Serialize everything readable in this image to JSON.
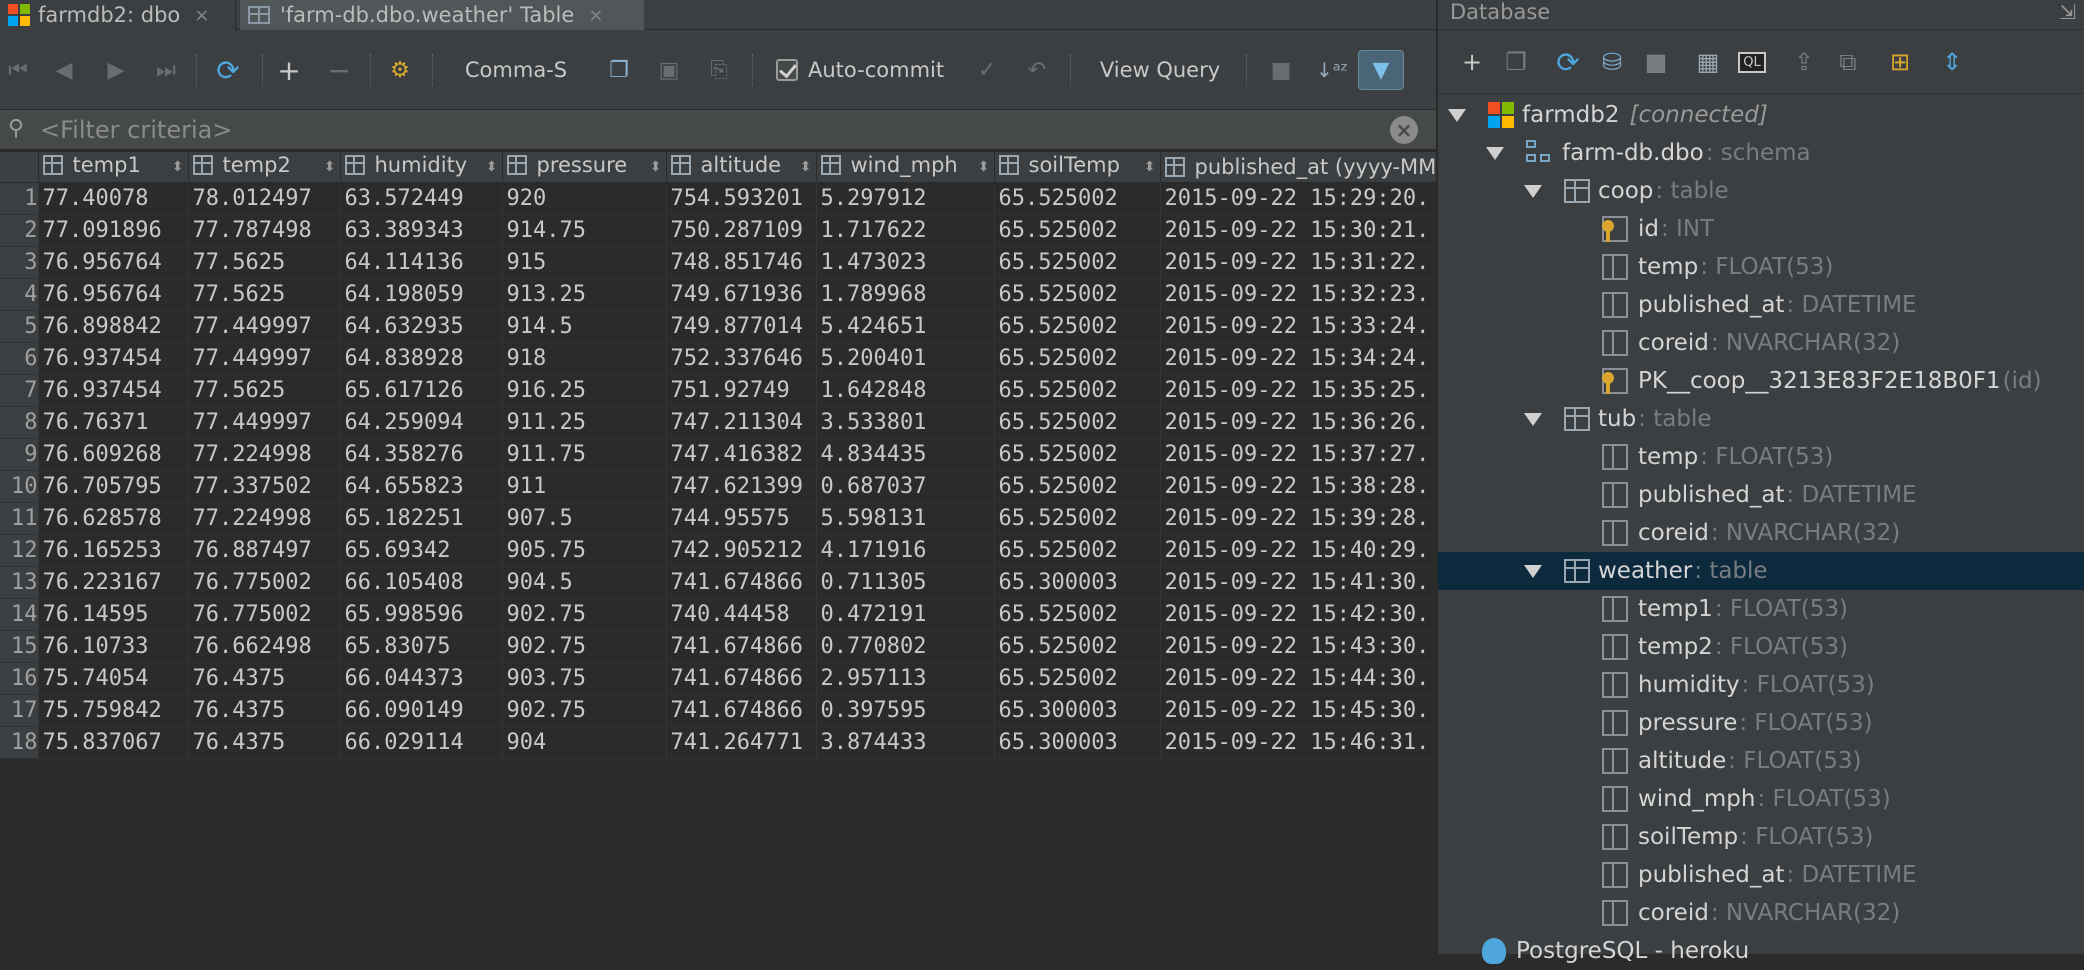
{
  "tabs": [
    {
      "label": "farmdb2: dbo",
      "close": "×"
    },
    {
      "label": "'farm-db.dbo.weather' Table",
      "close": "×"
    }
  ],
  "toolbar": {
    "comma_label": "Comma-S",
    "autocommit_label": "Auto-commit",
    "autocommit_checked": true,
    "view_query_label": "View Query"
  },
  "filter": {
    "placeholder": "<Filter criteria>"
  },
  "grid": {
    "columns": [
      "temp1",
      "temp2",
      "humidity",
      "pressure",
      "altitude",
      "wind_mph",
      "soilTemp",
      "published_at (yyyy-MM"
    ],
    "rows": [
      {
        "n": "1",
        "cells": [
          "77.40078",
          "78.012497",
          "63.572449",
          "920",
          "754.593201",
          "5.297912",
          "65.525002",
          "2015-09-22 15:29:20."
        ]
      },
      {
        "n": "2",
        "cells": [
          "77.091896",
          "77.787498",
          "63.389343",
          "914.75",
          "750.287109",
          "1.717622",
          "65.525002",
          "2015-09-22 15:30:21."
        ]
      },
      {
        "n": "3",
        "cells": [
          "76.956764",
          "77.5625",
          "64.114136",
          "915",
          "748.851746",
          "1.473023",
          "65.525002",
          "2015-09-22 15:31:22."
        ]
      },
      {
        "n": "4",
        "cells": [
          "76.956764",
          "77.5625",
          "64.198059",
          "913.25",
          "749.671936",
          "1.789968",
          "65.525002",
          "2015-09-22 15:32:23."
        ]
      },
      {
        "n": "5",
        "cells": [
          "76.898842",
          "77.449997",
          "64.632935",
          "914.5",
          "749.877014",
          "5.424651",
          "65.525002",
          "2015-09-22 15:33:24."
        ]
      },
      {
        "n": "6",
        "cells": [
          "76.937454",
          "77.449997",
          "64.838928",
          "918",
          "752.337646",
          "5.200401",
          "65.525002",
          "2015-09-22 15:34:24."
        ]
      },
      {
        "n": "7",
        "cells": [
          "76.937454",
          "77.5625",
          "65.617126",
          "916.25",
          "751.92749",
          "1.642848",
          "65.525002",
          "2015-09-22 15:35:25."
        ]
      },
      {
        "n": "8",
        "cells": [
          "76.76371",
          "77.449997",
          "64.259094",
          "911.25",
          "747.211304",
          "3.533801",
          "65.525002",
          "2015-09-22 15:36:26."
        ]
      },
      {
        "n": "9",
        "cells": [
          "76.609268",
          "77.224998",
          "64.358276",
          "911.75",
          "747.416382",
          "4.834435",
          "65.525002",
          "2015-09-22 15:37:27."
        ]
      },
      {
        "n": "10",
        "cells": [
          "76.705795",
          "77.337502",
          "64.655823",
          "911",
          "747.621399",
          "0.687037",
          "65.525002",
          "2015-09-22 15:38:28."
        ]
      },
      {
        "n": "11",
        "cells": [
          "76.628578",
          "77.224998",
          "65.182251",
          "907.5",
          "744.95575",
          "5.598131",
          "65.525002",
          "2015-09-22 15:39:28."
        ]
      },
      {
        "n": "12",
        "cells": [
          "76.165253",
          "76.887497",
          "65.69342",
          "905.75",
          "742.905212",
          "4.171916",
          "65.525002",
          "2015-09-22 15:40:29."
        ]
      },
      {
        "n": "13",
        "cells": [
          "76.223167",
          "76.775002",
          "66.105408",
          "904.5",
          "741.674866",
          "0.711305",
          "65.300003",
          "2015-09-22 15:41:30."
        ]
      },
      {
        "n": "14",
        "cells": [
          "76.14595",
          "76.775002",
          "65.998596",
          "902.75",
          "740.44458",
          "0.472191",
          "65.525002",
          "2015-09-22 15:42:30."
        ]
      },
      {
        "n": "15",
        "cells": [
          "76.10733",
          "76.662498",
          "65.83075",
          "902.75",
          "741.674866",
          "0.770802",
          "65.525002",
          "2015-09-22 15:43:30."
        ]
      },
      {
        "n": "16",
        "cells": [
          "75.74054",
          "76.4375",
          "66.044373",
          "903.75",
          "741.674866",
          "2.957113",
          "65.525002",
          "2015-09-22 15:44:30."
        ]
      },
      {
        "n": "17",
        "cells": [
          "75.759842",
          "76.4375",
          "66.090149",
          "902.75",
          "741.674866",
          "0.397595",
          "65.300003",
          "2015-09-22 15:45:30."
        ]
      },
      {
        "n": "18",
        "cells": [
          "75.837067",
          "76.4375",
          "66.029114",
          "904",
          "741.264771",
          "3.874433",
          "65.300003",
          "2015-09-22 15:46:31."
        ]
      }
    ]
  },
  "database": {
    "title": "Database",
    "tree": [
      {
        "name": "farmdb2",
        "extra": "[connected]",
        "icon": "ms-logo"
      },
      {
        "name": "farm-db.dbo",
        "type": ": schema",
        "icon": "schema-icon"
      },
      {
        "name": "coop",
        "type": ": table",
        "icon": "table-icon"
      },
      {
        "name": "id",
        "type": ": INT",
        "icon": "key-column-icon"
      },
      {
        "name": "temp",
        "type": ": FLOAT(53)",
        "icon": "column-icon"
      },
      {
        "name": "published_at",
        "type": ": DATETIME",
        "icon": "column-icon"
      },
      {
        "name": "coreid",
        "type": ": NVARCHAR(32)",
        "icon": "column-icon"
      },
      {
        "name": "PK__coop__3213E83F2E18B0F1",
        "type": " (id)",
        "icon": "primary-key-icon"
      },
      {
        "name": "tub",
        "type": ": table",
        "icon": "table-icon"
      },
      {
        "name": "temp",
        "type": ": FLOAT(53)",
        "icon": "column-icon"
      },
      {
        "name": "published_at",
        "type": ": DATETIME",
        "icon": "column-icon"
      },
      {
        "name": "coreid",
        "type": ": NVARCHAR(32)",
        "icon": "column-icon"
      },
      {
        "name": "weather",
        "type": ": table",
        "icon": "table-icon"
      },
      {
        "name": "temp1",
        "type": ": FLOAT(53)",
        "icon": "column-icon"
      },
      {
        "name": "temp2",
        "type": ": FLOAT(53)",
        "icon": "column-icon"
      },
      {
        "name": "humidity",
        "type": ": FLOAT(53)",
        "icon": "column-icon"
      },
      {
        "name": "pressure",
        "type": ": FLOAT(53)",
        "icon": "column-icon"
      },
      {
        "name": "altitude",
        "type": ": FLOAT(53)",
        "icon": "column-icon"
      },
      {
        "name": "wind_mph",
        "type": ": FLOAT(53)",
        "icon": "column-icon"
      },
      {
        "name": "soilTemp",
        "type": ": FLOAT(53)",
        "icon": "column-icon"
      },
      {
        "name": "published_at",
        "type": ": DATETIME",
        "icon": "column-icon"
      },
      {
        "name": "coreid",
        "type": ": NVARCHAR(32)",
        "icon": "column-icon"
      },
      {
        "name": "PostgreSQL - heroku",
        "icon": "postgres-icon"
      }
    ]
  },
  "colors": {
    "selection": "#0d293e",
    "accent": "#4ea6dc",
    "background": "#2b2b2b",
    "panel": "#3c3f41"
  }
}
